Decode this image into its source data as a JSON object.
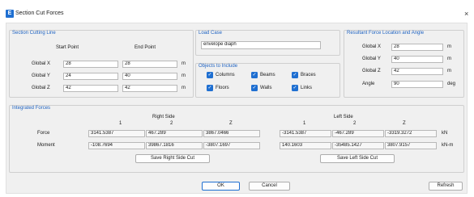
{
  "window": {
    "title": "Section Cut Forces",
    "app_icon_letter": "E",
    "close_glyph": "×"
  },
  "section_cutting_line": {
    "title": "Section Cutting Line",
    "start_header": "Start Point",
    "end_header": "End Point",
    "rows": [
      {
        "label": "Global  X",
        "start": "28",
        "end": "28",
        "unit": "m"
      },
      {
        "label": "Global  Y",
        "start": "24",
        "end": "40",
        "unit": "m"
      },
      {
        "label": "Global  Z",
        "start": "42",
        "end": "42",
        "unit": "m"
      }
    ]
  },
  "load_case": {
    "title": "Load Case",
    "value": "envelope diaph"
  },
  "objects": {
    "title": "Objects to Include",
    "items": [
      {
        "label": "Columns",
        "checked": true
      },
      {
        "label": "Beams",
        "checked": true
      },
      {
        "label": "Braces",
        "checked": true
      },
      {
        "label": "Floors",
        "checked": true
      },
      {
        "label": "Walls",
        "checked": true
      },
      {
        "label": "Links",
        "checked": true
      }
    ],
    "check_glyph": "✓"
  },
  "resultant": {
    "title": "Resultant Force Location and Angle",
    "rows": [
      {
        "label": "Global  X",
        "value": "28",
        "unit": "m"
      },
      {
        "label": "Global  Y",
        "value": "40",
        "unit": "m"
      },
      {
        "label": "Global  Z",
        "value": "42",
        "unit": "m"
      },
      {
        "label": "Angle",
        "value": "90",
        "unit": "deg"
      }
    ]
  },
  "integrated": {
    "title": "Integrated Forces",
    "right_side": {
      "header": "Right Side",
      "cols": [
        "1",
        "2",
        "Z"
      ],
      "force": [
        "3141.5387",
        "467.289",
        "3867.0466"
      ],
      "moment": [
        "-108.7694",
        "39867.1816",
        "-3807.1697"
      ],
      "save_label": "Save Right Side Cut"
    },
    "left_side": {
      "header": "Left Side",
      "cols": [
        "1",
        "2",
        "Z"
      ],
      "force": [
        "-3141.5387",
        "-467.289",
        "-3319.3272"
      ],
      "moment": [
        "140.1603",
        "-35485.1427",
        "3807.9157"
      ],
      "save_label": "Save Left Side Cut"
    },
    "row_labels": [
      "Force",
      "Moment"
    ],
    "units": [
      "kN",
      "kN-m"
    ]
  },
  "footer": {
    "ok": "OK",
    "cancel": "Cancel",
    "refresh": "Refresh"
  }
}
